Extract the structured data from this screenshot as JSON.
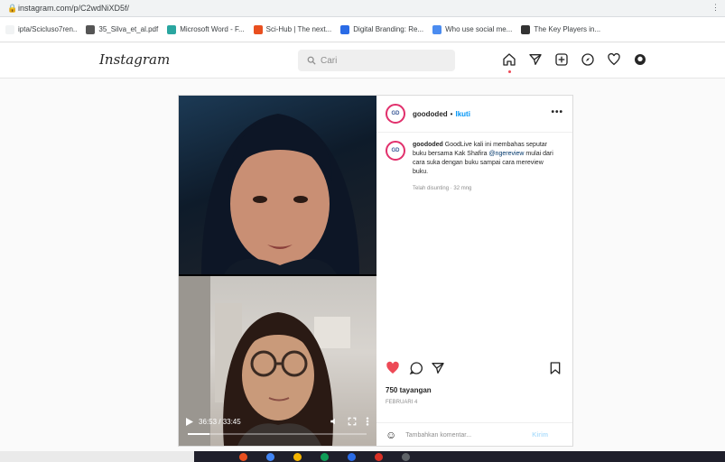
{
  "browser": {
    "url": "instagram.com/p/C2wdNiXD5f/",
    "bookmarks": [
      {
        "label": "ipta/Scicluso7ren..",
        "color": "#f1f3f4"
      },
      {
        "label": "35_Silva_et_al.pdf",
        "color": "#555555"
      },
      {
        "label": "Microsoft Word - F...",
        "color": "#2aa6a0"
      },
      {
        "label": "Sci-Hub | The next...",
        "color": "#e94f1f"
      },
      {
        "label": "Digital Branding: Re...",
        "color": "#2a6be6"
      },
      {
        "label": "Who use social me...",
        "color": "#4b8cf0"
      },
      {
        "label": "The Key Players in...",
        "color": "#333333"
      }
    ]
  },
  "nav": {
    "logo": "Instagram",
    "search_placeholder": "Cari"
  },
  "post": {
    "username": "goododed",
    "separator": "•",
    "follow_label": "Ikuti",
    "more_label": "•••",
    "caption_user": "goododed",
    "caption_text_1": "GoodLive kali ini membahas seputar buku bersama Kak Shafira",
    "caption_mention": "@ngereview",
    "caption_text_2": "mulai dari cara suka dengan buku sampai cara mereview buku.",
    "edited": "Telah disunting · 32 mng",
    "views": "750 tayangan",
    "date": "Februari 4",
    "comment_placeholder": "Tambahkan komentar...",
    "post_label": "Kirim",
    "video_time": "36:53 / 33:45",
    "video_progress": 0.12
  },
  "colors": {
    "accent": "#0095f6",
    "like": "#ed4956"
  }
}
